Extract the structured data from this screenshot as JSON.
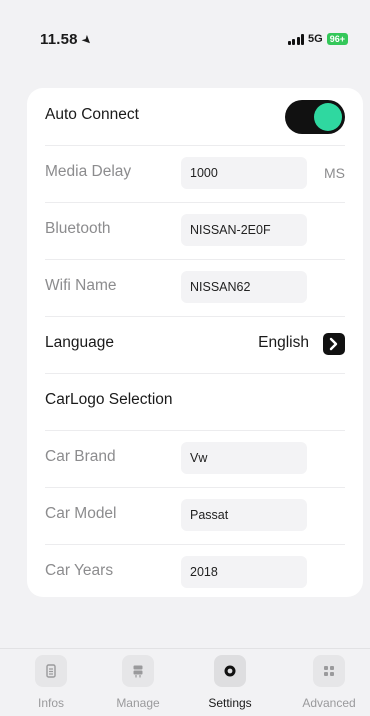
{
  "status_bar": {
    "time": "11.58",
    "network": "5G",
    "battery": "96+"
  },
  "settings": {
    "auto_connect": {
      "label": "Auto Connect",
      "enabled": true
    },
    "media_delay": {
      "label": "Media Delay",
      "value": "1000",
      "unit": "MS"
    },
    "bluetooth": {
      "label": "Bluetooth",
      "value": "NISSAN-2E0F"
    },
    "wifi_name": {
      "label": "Wifi Name",
      "value": "NISSAN62"
    },
    "language": {
      "label": "Language",
      "value": "English"
    },
    "carlogo_section": {
      "label": "CarLogo Selection"
    },
    "car_brand": {
      "label": "Car Brand",
      "value": "Vw"
    },
    "car_model": {
      "label": "Car Model",
      "value": "Passat"
    },
    "car_years": {
      "label": "Car Years",
      "value": "2018"
    }
  },
  "tabs": [
    {
      "label": "Infos",
      "icon": "document-icon",
      "active": false
    },
    {
      "label": "Manage",
      "icon": "server-icon",
      "active": false
    },
    {
      "label": "Settings",
      "icon": "settings-ring-icon",
      "active": true
    },
    {
      "label": "Advanced",
      "icon": "grid-icon",
      "active": false
    }
  ],
  "colors": {
    "accent": "#2fd8a0",
    "toggle_track": "#111111",
    "battery": "#34c759"
  }
}
